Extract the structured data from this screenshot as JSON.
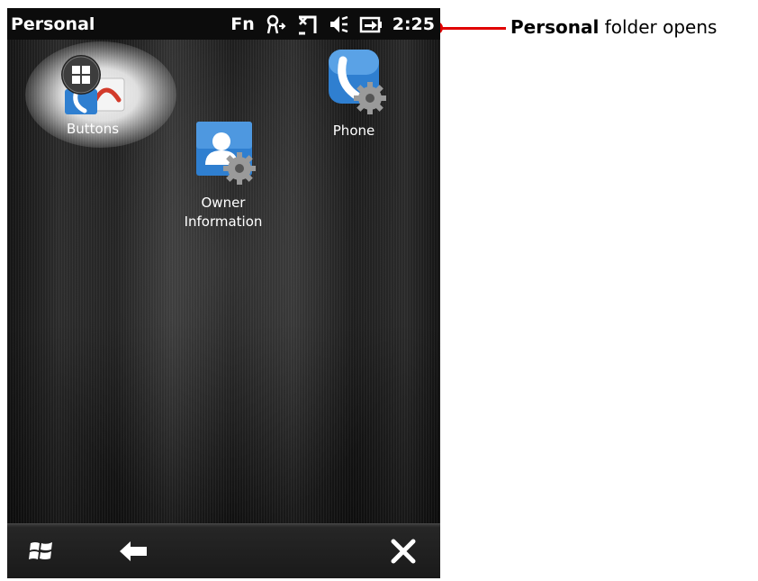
{
  "title_bar": {
    "title": "Personal",
    "fn_label": "Fn",
    "time": "2:25",
    "icons": [
      "network-icon",
      "signal-off-icon",
      "speaker-icon",
      "battery-icon"
    ]
  },
  "apps": [
    {
      "label": "Buttons",
      "icon": "buttons-icon",
      "selected": true
    },
    {
      "label_line1": "Owner",
      "label_line2": "Information",
      "icon": "owner-information-icon"
    },
    {
      "label": "Phone",
      "icon": "phone-settings-icon"
    }
  ],
  "bottom_bar": {
    "icons": [
      "start-icon",
      "back-arrow-icon",
      "close-icon"
    ]
  },
  "callout": {
    "bold_text": "Personal",
    "text": " folder opens",
    "color": "#e00000"
  },
  "colors": {
    "icon_blue": "#2f7fd0",
    "title_bar_bg": "#0c0c0c"
  }
}
